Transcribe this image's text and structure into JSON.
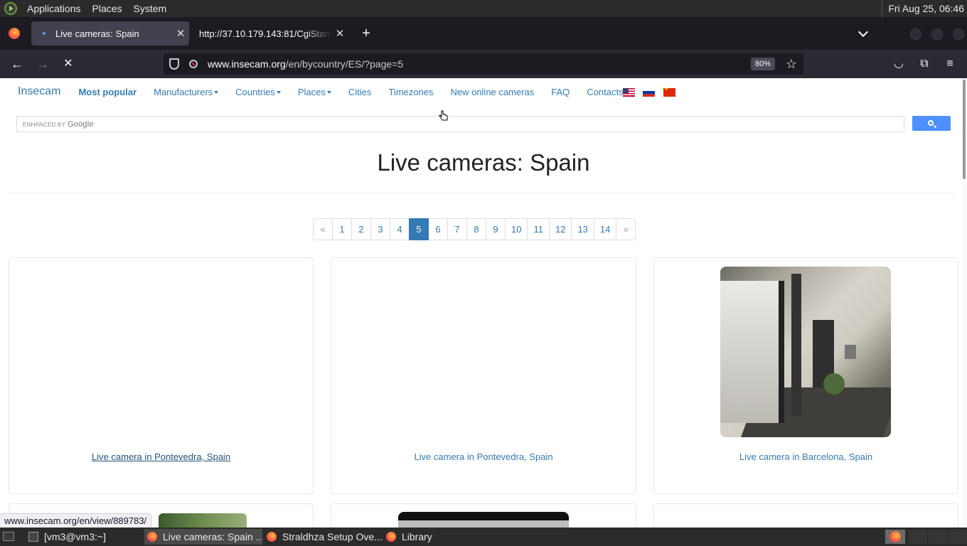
{
  "panel": {
    "menus": [
      "Applications",
      "Places",
      "System"
    ],
    "clock": "Fri Aug 25, 06:46"
  },
  "tabs": [
    {
      "title": "Live cameras: Spain"
    },
    {
      "title": "http://37.10.179.143:81/CgiStart"
    }
  ],
  "nav": {
    "url_domain": "www.insecam.org",
    "url_path": "/en/bycountry/ES/?page=5",
    "zoom": "80%"
  },
  "site": {
    "brand": "Insecam",
    "links": [
      "Most popular",
      "Manufacturers",
      "Countries",
      "Places",
      "Cities",
      "Timezones",
      "New online cameras",
      "FAQ",
      "Contacts"
    ],
    "search_brand": "ENHANCED BY",
    "search_brand_name": "Google",
    "heading": "Live cameras: Spain",
    "pager": [
      "«",
      "1",
      "2",
      "3",
      "4",
      "5",
      "6",
      "7",
      "8",
      "9",
      "10",
      "11",
      "12",
      "13",
      "14",
      "»"
    ],
    "current_page": "5",
    "cards": [
      {
        "caption": "Live camera in Pontevedra, Spain"
      },
      {
        "caption": "Live camera in Pontevedra, Spain"
      },
      {
        "caption": "Live camera in Barcelona, Spain"
      }
    ]
  },
  "status_url": "www.insecam.org/en/view/889783/",
  "taskbar": [
    {
      "label": "[vm3@vm3:~]"
    },
    {
      "label": "Live cameras: Spain ..."
    },
    {
      "label": "Straldhza Setup Ove..."
    },
    {
      "label": "Library"
    }
  ],
  "colors": {
    "link": "#337ab7",
    "pager_active": "#337ab7",
    "search_button": "#4d90fe"
  }
}
